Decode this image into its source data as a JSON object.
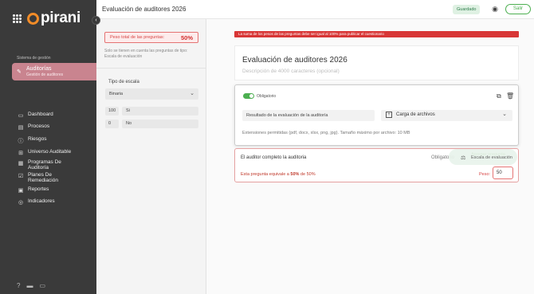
{
  "sidebar": {
    "logo_text": "pirani",
    "module_section_label": "Sistema de gestión",
    "module": {
      "title": "Auditorías",
      "subtitle": "Gestión de auditores",
      "icon": "pen-icon"
    },
    "nav": [
      {
        "label": "Dashboard",
        "icon": "monitor-icon"
      },
      {
        "label": "Procesos",
        "icon": "screen-icon"
      },
      {
        "label": "Riesgos",
        "icon": "alert-circle-icon"
      },
      {
        "label": "Universo Auditable",
        "icon": "grid-icon"
      },
      {
        "label": "Programas De Auditoría",
        "icon": "calendar-icon"
      },
      {
        "label": "Planes De Remediación",
        "icon": "check-square-icon"
      },
      {
        "label": "Reportes",
        "icon": "report-icon"
      },
      {
        "label": "Indicadores",
        "icon": "target-icon"
      }
    ],
    "bottom_icons": [
      "help-icon",
      "folder-icon",
      "card-icon"
    ]
  },
  "topbar": {
    "title": "Evaluación de auditores 2026",
    "status_badge": "Guardado",
    "exit_label": "Salir"
  },
  "settings_panel": {
    "weight_label": "Peso total de las preguntas:",
    "weight_value": "50%",
    "weight_note": "Solo se tienen en cuenta las preguntas de tipo: Escala de evaluación",
    "scale_label": "Tipo de escala",
    "scale_value": "Binaria",
    "options": [
      {
        "value": "100",
        "label": "Si"
      },
      {
        "value": "0",
        "label": "No"
      }
    ]
  },
  "editor": {
    "alert": "La suma de los pesos de las preguntas debe ser igual al 100% para publicar el cuestionario",
    "form_title": "Evaluación de auditores 2026",
    "form_description_placeholder": "Descripción de 4000 caracteres (opcional)",
    "active_question": {
      "required_label": "Obligatorio",
      "question_text": "Resultado de la evaluación de la auditoría",
      "type_label": "Carga de archivos",
      "hint": "Extensiones permitidas (pdf, docx, xlsx, png, jpg). Tamaño máximo por archivo: 10 MB"
    },
    "second_question": {
      "title": "El auditor completo la auditoria",
      "required_label": "Obligatorio",
      "type_label": "Escala de evaluación",
      "ghost_label": "Agregar pregunta",
      "weight_prefix": "Esta pregunta equivale a ",
      "weight_percent": "50%",
      "weight_suffix": " de 50%",
      "peso_label": "Peso:",
      "peso_value": "50"
    }
  },
  "colors": {
    "accent_green": "#4caf50",
    "alert_red": "#d83636",
    "module_pink": "#c9848f",
    "sidebar_bg": "#3a3a3a",
    "logo_orange": "#f28c28"
  }
}
